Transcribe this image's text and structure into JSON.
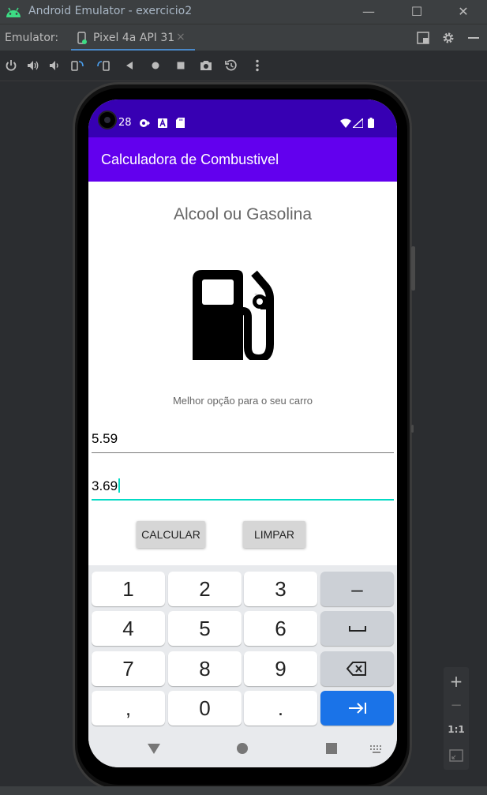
{
  "window": {
    "title": "Android Emulator - exercicio2",
    "controls": {
      "minimize": "—",
      "maximize": "☐",
      "close": "✕"
    }
  },
  "tabbar": {
    "emulator_label": "Emulator:",
    "tab_label": "Pixel 4a API 31",
    "tab_close": "×"
  },
  "toolbar": {
    "icons": [
      "power-icon",
      "volume-up-icon",
      "volume-down-icon",
      "rotate-left-icon",
      "rotate-right-icon",
      "back-icon",
      "home-icon",
      "overview-icon",
      "camera-icon",
      "snapshot-icon",
      "more-icon"
    ]
  },
  "phone": {
    "status_time": "28",
    "app_title": "Calculadora de Combustivel",
    "heading": "Alcool ou Gasolina",
    "subtitle": "Melhor opção para o seu carro",
    "field_alcool": "5.59",
    "field_gasolina": "3.69",
    "btn_calcular": "CALCULAR",
    "btn_limpar": "LIMPAR",
    "keys": {
      "k1": "1",
      "k2": "2",
      "k3": "3",
      "kminus": "–",
      "k4": "4",
      "k5": "5",
      "k6": "6",
      "k7": "7",
      "k8": "8",
      "k9": "9",
      "kcomma": ",",
      "k0": "0",
      "kdot": "."
    }
  },
  "zoom": {
    "plus": "+",
    "minus": "−",
    "ratio": "1:1"
  },
  "colors": {
    "status": "#3700b3",
    "appbar": "#6200ee",
    "accent": "#03dac5",
    "key_action": "#1a73e8"
  }
}
